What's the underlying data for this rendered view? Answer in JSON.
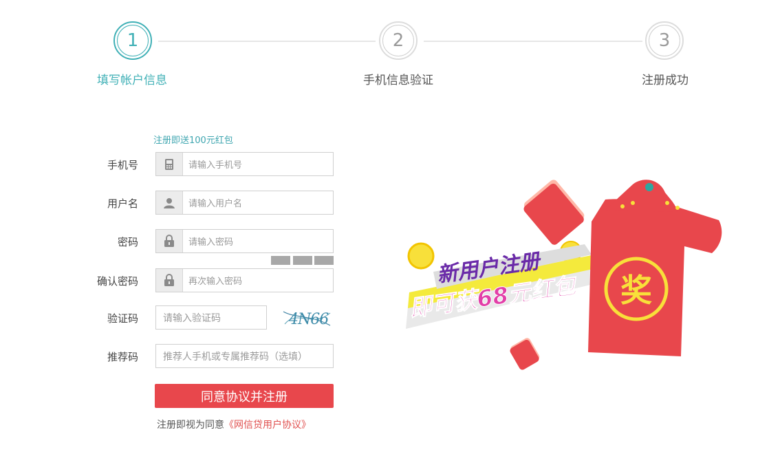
{
  "steps": [
    {
      "number": "1",
      "label": "填写帐户信息",
      "active": true
    },
    {
      "number": "2",
      "label": "手机信息验证",
      "active": false
    },
    {
      "number": "3",
      "label": "注册成功",
      "active": false
    }
  ],
  "form": {
    "promo_text": "注册即送100元红包",
    "phone": {
      "label": "手机号",
      "placeholder": "请输入手机号"
    },
    "username": {
      "label": "用户名",
      "placeholder": "请输入用户名"
    },
    "password": {
      "label": "密码",
      "placeholder": "请输入密码"
    },
    "confirm_password": {
      "label": "确认密码",
      "placeholder": "再次输入密码"
    },
    "captcha": {
      "label": "验证码",
      "placeholder": "请输入验证码",
      "image_text": "4N66"
    },
    "referral": {
      "label": "推荐码",
      "placeholder": "推荐人手机或专属推荐码（选填）"
    },
    "submit_label": "同意协议并注册",
    "agreement_prefix": "注册即视为同意",
    "agreement_link": "《网信贷用户协议》"
  },
  "banner": {
    "line1": "新用户注册",
    "line2": "即可获68元红包",
    "badge": "奖"
  },
  "colors": {
    "accent": "#3fb0b6",
    "submit": "#e8474c",
    "envelope": "#e8474c"
  }
}
